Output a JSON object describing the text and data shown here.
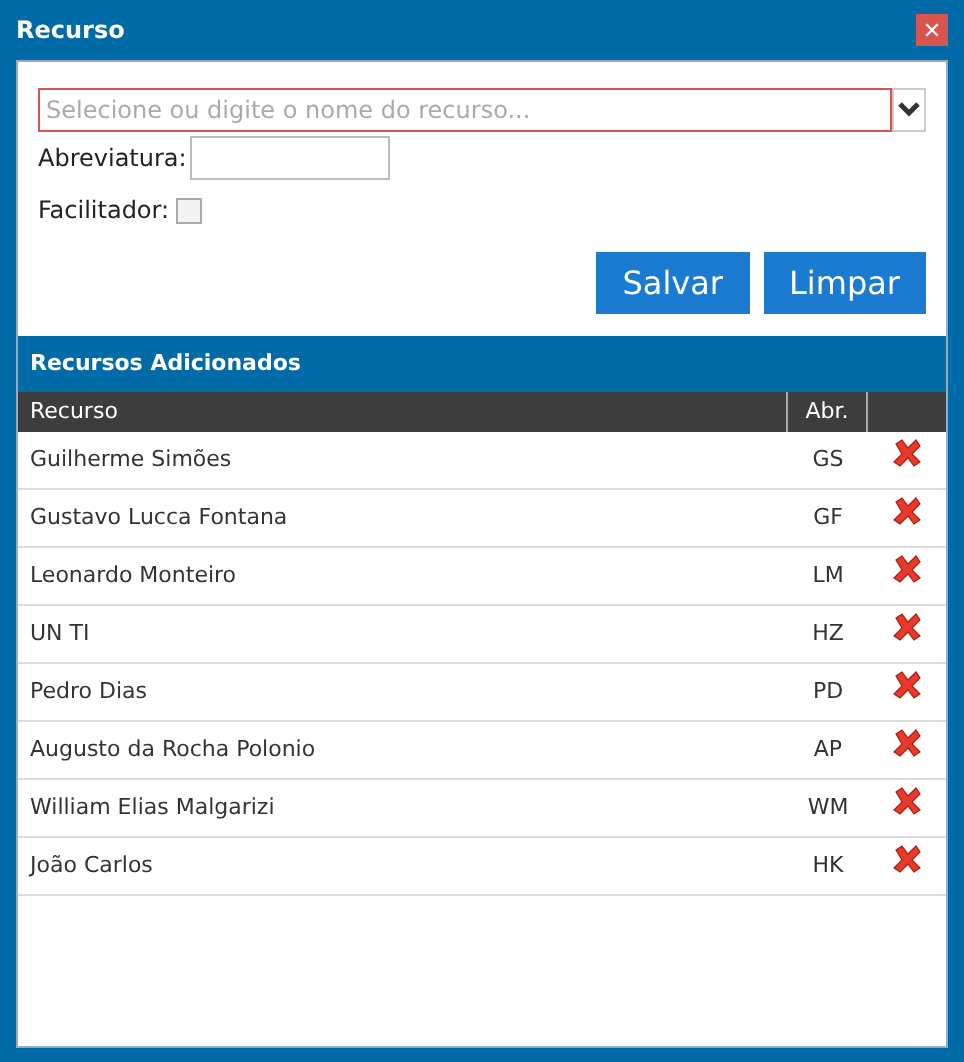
{
  "window": {
    "title": "Recurso",
    "close": "✕"
  },
  "form": {
    "resource_placeholder": "Selecione ou digite o nome do recurso...",
    "abbrev_label": "Abreviatura:",
    "facilitator_label": "Facilitador:",
    "facilitator_checked": false
  },
  "buttons": [
    "Salvar",
    "Limpar"
  ],
  "section_title": "Recursos Adicionados",
  "table": {
    "columns": [
      "Recurso",
      "Abr."
    ],
    "rows": [
      {
        "name": "Guilherme Simões",
        "abbr": "GS"
      },
      {
        "name": "Gustavo Lucca Fontana",
        "abbr": "GF"
      },
      {
        "name": "Leonardo Monteiro",
        "abbr": "LM"
      },
      {
        "name": "UN TI",
        "abbr": "HZ"
      },
      {
        "name": "Pedro Dias",
        "abbr": "PD"
      },
      {
        "name": "Augusto da Rocha Polonio",
        "abbr": "AP"
      },
      {
        "name": "William Elias Malgarizi",
        "abbr": "WM"
      },
      {
        "name": "João Carlos",
        "abbr": "HK"
      }
    ]
  }
}
